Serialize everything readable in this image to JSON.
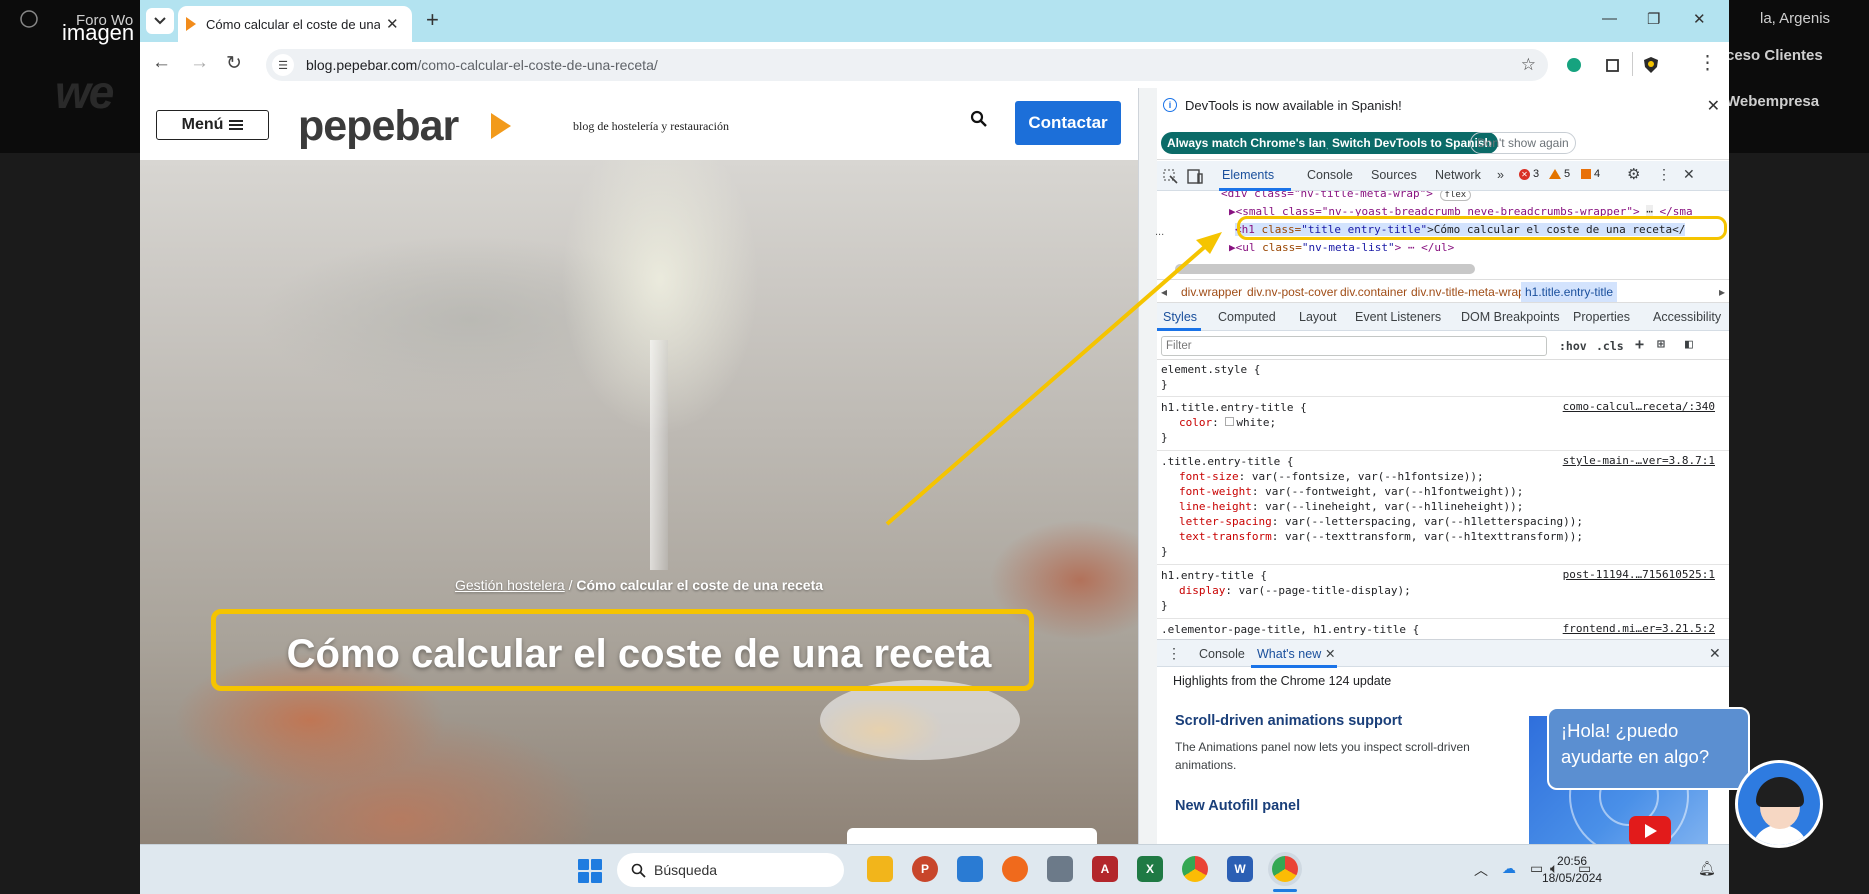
{
  "background_page": {
    "label": "imagen",
    "items": [
      "Foro Wo",
      "la, Argenis",
      "ceso Clientes",
      "Webempresa"
    ],
    "logo": "we"
  },
  "browser": {
    "tab_title": "Cómo calcular el coste de una r",
    "url_host": "blog.pepebar.com",
    "url_path": "/como-calcular-el-coste-de-una-receta/"
  },
  "site": {
    "menu_label": "Menú",
    "logo_text": "pepebar",
    "tagline": "blog de hostelería y restauración",
    "contact_label": "Contactar",
    "breadcrumb_link": "Gestión hostelera",
    "breadcrumb_sep": " / ",
    "breadcrumb_current": "Cómo calcular el coste de una receta",
    "title": "Cómo calcular el coste de una receta"
  },
  "devtools": {
    "info_text": "DevTools is now available in Spanish!",
    "btn_match": "Always match Chrome's language",
    "btn_switch": "Switch DevTools to Spanish",
    "btn_dont_show": "Don't show again",
    "tabs": [
      "Elements",
      "Console",
      "Sources",
      "Network"
    ],
    "badge_errors": "3",
    "badge_warnings": "5",
    "badge_issues": "4",
    "dom": {
      "line1_tag": "<div class=\"nv-title-meta-wrap\">",
      "line1_flex": "flex",
      "line2": "<small class=\"nv--yoast-breadcrumb neve-breadcrumbs-wrapper\">",
      "line2_end": "</sma",
      "line3_open": "<h1 ",
      "line3_attr": "class=",
      "line3_val": "\"title entry-title\"",
      "line3_text": ">Cómo calcular el coste de una receta</",
      "line4_open": "<ul ",
      "line4_attr": "class=",
      "line4_val": "\"nv-meta-list\"",
      "line4_close": "> ⋯ </ul>",
      "ellipsis": "..."
    },
    "crumbs": [
      "div.wrapper",
      "div.nv-post-cover",
      "div.container",
      "div.nv-title-meta-wrap",
      "h1.title.entry-title"
    ],
    "style_tabs": [
      "Styles",
      "Computed",
      "Layout",
      "Event Listeners",
      "DOM Breakpoints",
      "Properties",
      "Accessibility"
    ],
    "filter_placeholder": "Filter",
    "hov": ":hov",
    "cls": ".cls",
    "rules": {
      "r0_sel": "element.style {",
      "r1_sel": "h1.title.entry-title {",
      "r1_src": "como-calcul…receta/:340",
      "r1_p1": "color",
      "r1_v1": "white;",
      "r2_sel": ".title.entry-title {",
      "r2_src": "style-main-…ver=3.8.7:1",
      "r2_p1": "font-size",
      "r2_v1": "var(--fontsize, var(--h1fontsize));",
      "r2_p2": "font-weight",
      "r2_v2": "var(--fontweight, var(--h1fontweight));",
      "r2_p3": "line-height",
      "r2_v3": "var(--lineheight, var(--h1lineheight));",
      "r2_p4": "letter-spacing",
      "r2_v4": "var(--letterspacing, var(--h1letterspacing));",
      "r2_p5": "text-transform",
      "r2_v5": "var(--texttransform, var(--h1texttransform));",
      "r3_sel": "h1.entry-title {",
      "r3_src": "post-11194.…715610525:1",
      "r3_p1": "display",
      "r3_v1": "var(--page-title-display);",
      "r4_sel": ".elementor-page-title, h1.entry-title {",
      "r4_src": "frontend.mi…er=3.21.5:2",
      "close_brace": "}"
    },
    "drawer_tabs": [
      "Console",
      "What's new"
    ],
    "whatsnew": {
      "highlights": "Highlights from the Chrome 124 update",
      "h1": "Scroll-driven animations support",
      "p1": "The Animations panel now lets you inspect scroll-driven animations.",
      "h2": "New Autofill panel"
    }
  },
  "chat": {
    "bubble": "¡Hola! ¿puedo ayudarte en algo?"
  },
  "taskbar": {
    "search_label": "Búsqueda",
    "time": "20:56",
    "date": "18/05/2024"
  }
}
